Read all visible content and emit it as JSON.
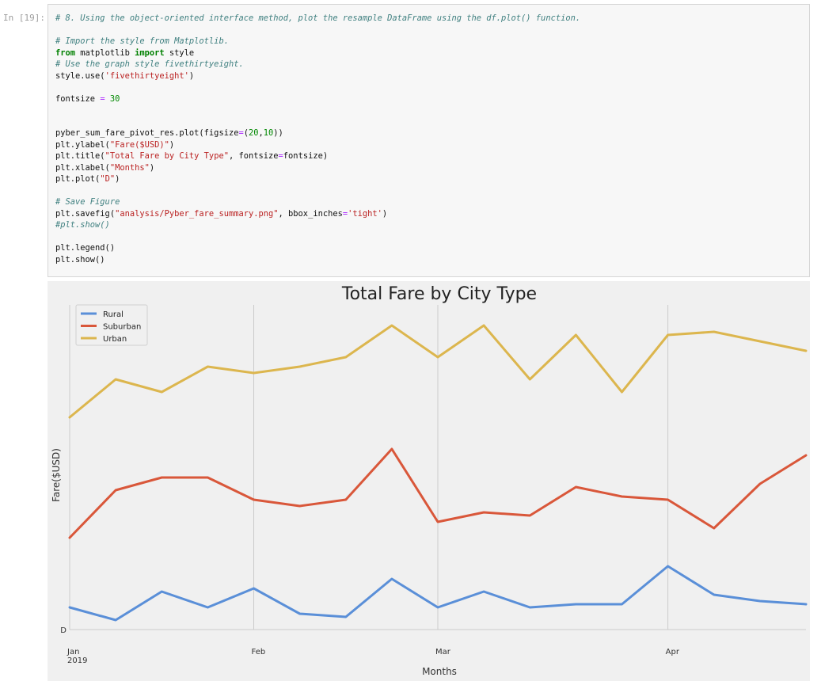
{
  "cell": {
    "prompt": "In [19]:",
    "lines": [
      [
        {
          "t": "comment",
          "v": "# 8. Using the object-oriented interface method, plot the resample DataFrame using the df.plot() function."
        }
      ],
      [],
      [
        {
          "t": "comment",
          "v": "# Import the style from Matplotlib."
        }
      ],
      [
        {
          "t": "kw",
          "v": "from"
        },
        {
          "t": "plain",
          "v": " matplotlib "
        },
        {
          "t": "kw",
          "v": "import"
        },
        {
          "t": "plain",
          "v": " style"
        }
      ],
      [
        {
          "t": "comment",
          "v": "# Use the graph style fivethirtyeight."
        }
      ],
      [
        {
          "t": "plain",
          "v": "style.use("
        },
        {
          "t": "str",
          "v": "'fivethirtyeight'"
        },
        {
          "t": "plain",
          "v": ")"
        }
      ],
      [],
      [
        {
          "t": "plain",
          "v": "fontsize "
        },
        {
          "t": "op",
          "v": "="
        },
        {
          "t": "plain",
          "v": " "
        },
        {
          "t": "num",
          "v": "30"
        }
      ],
      [],
      [],
      [
        {
          "t": "plain",
          "v": "pyber_sum_fare_pivot_res.plot(figsize"
        },
        {
          "t": "op",
          "v": "="
        },
        {
          "t": "plain",
          "v": "("
        },
        {
          "t": "num",
          "v": "20"
        },
        {
          "t": "plain",
          "v": ","
        },
        {
          "t": "num",
          "v": "10"
        },
        {
          "t": "plain",
          "v": "))"
        }
      ],
      [
        {
          "t": "plain",
          "v": "plt.ylabel("
        },
        {
          "t": "str",
          "v": "\"Fare($USD)\""
        },
        {
          "t": "plain",
          "v": ")"
        }
      ],
      [
        {
          "t": "plain",
          "v": "plt.title("
        },
        {
          "t": "str",
          "v": "\"Total Fare by City Type\""
        },
        {
          "t": "plain",
          "v": ", fontsize"
        },
        {
          "t": "op",
          "v": "="
        },
        {
          "t": "plain",
          "v": "fontsize)"
        }
      ],
      [
        {
          "t": "plain",
          "v": "plt.xlabel("
        },
        {
          "t": "str",
          "v": "\"Months\""
        },
        {
          "t": "plain",
          "v": ")"
        }
      ],
      [
        {
          "t": "plain",
          "v": "plt.plot("
        },
        {
          "t": "str",
          "v": "\"D\""
        },
        {
          "t": "plain",
          "v": ")"
        }
      ],
      [],
      [
        {
          "t": "comment",
          "v": "# Save Figure"
        }
      ],
      [
        {
          "t": "plain",
          "v": "plt.savefig("
        },
        {
          "t": "str",
          "v": "\"analysis/Pyber_fare_summary.png\""
        },
        {
          "t": "plain",
          "v": ", bbox_inches"
        },
        {
          "t": "op",
          "v": "="
        },
        {
          "t": "str",
          "v": "'tight'"
        },
        {
          "t": "plain",
          "v": ")"
        }
      ],
      [
        {
          "t": "comment",
          "v": "#plt.show()"
        }
      ],
      [],
      [
        {
          "t": "plain",
          "v": "plt.legend()"
        }
      ],
      [
        {
          "t": "plain",
          "v": "plt.show()"
        }
      ]
    ]
  },
  "colors": {
    "rural": "#5a8fd8",
    "suburban": "#d9573a",
    "urban": "#dcb64e",
    "plot_bg": "#f0f0f0",
    "grid": "#cbcbcb"
  },
  "chart_data": {
    "type": "line",
    "title": "Total Fare by City Type",
    "xlabel": "Months",
    "ylabel": "Fare($USD)",
    "x": [
      "2019-01-06",
      "2019-01-13",
      "2019-01-20",
      "2019-01-27",
      "2019-02-03",
      "2019-02-10",
      "2019-02-17",
      "2019-02-24",
      "2019-03-03",
      "2019-03-10",
      "2019-03-17",
      "2019-03-24",
      "2019-03-31",
      "2019-04-07",
      "2019-04-14",
      "2019-04-21",
      "2019-04-28"
    ],
    "x_ticks": [
      {
        "label": "Jan",
        "sub": "2019",
        "index": 0
      },
      {
        "label": "Feb",
        "sub": "",
        "index": 4
      },
      {
        "label": "Mar",
        "sub": "",
        "index": 8
      },
      {
        "label": "Apr",
        "sub": "",
        "index": 13
      }
    ],
    "y_ticks": [
      "D"
    ],
    "ylim": [
      0,
      100
    ],
    "grid": true,
    "legend": "top-left",
    "series": [
      {
        "name": "Rural",
        "color": "#5a8fd8",
        "values": [
          7,
          3,
          12,
          7,
          13,
          5,
          4,
          16,
          7,
          12,
          7,
          8,
          8,
          20,
          11,
          9,
          8
        ]
      },
      {
        "name": "Suburban",
        "color": "#d9573a",
        "values": [
          29,
          44,
          48,
          48,
          41,
          39,
          41,
          57,
          34,
          37,
          36,
          45,
          42,
          41,
          32,
          46,
          55
        ]
      },
      {
        "name": "Urban",
        "color": "#dcb64e",
        "values": [
          67,
          79,
          75,
          83,
          81,
          83,
          86,
          96,
          86,
          96,
          79,
          93,
          75,
          93,
          94,
          91,
          88
        ]
      }
    ]
  }
}
